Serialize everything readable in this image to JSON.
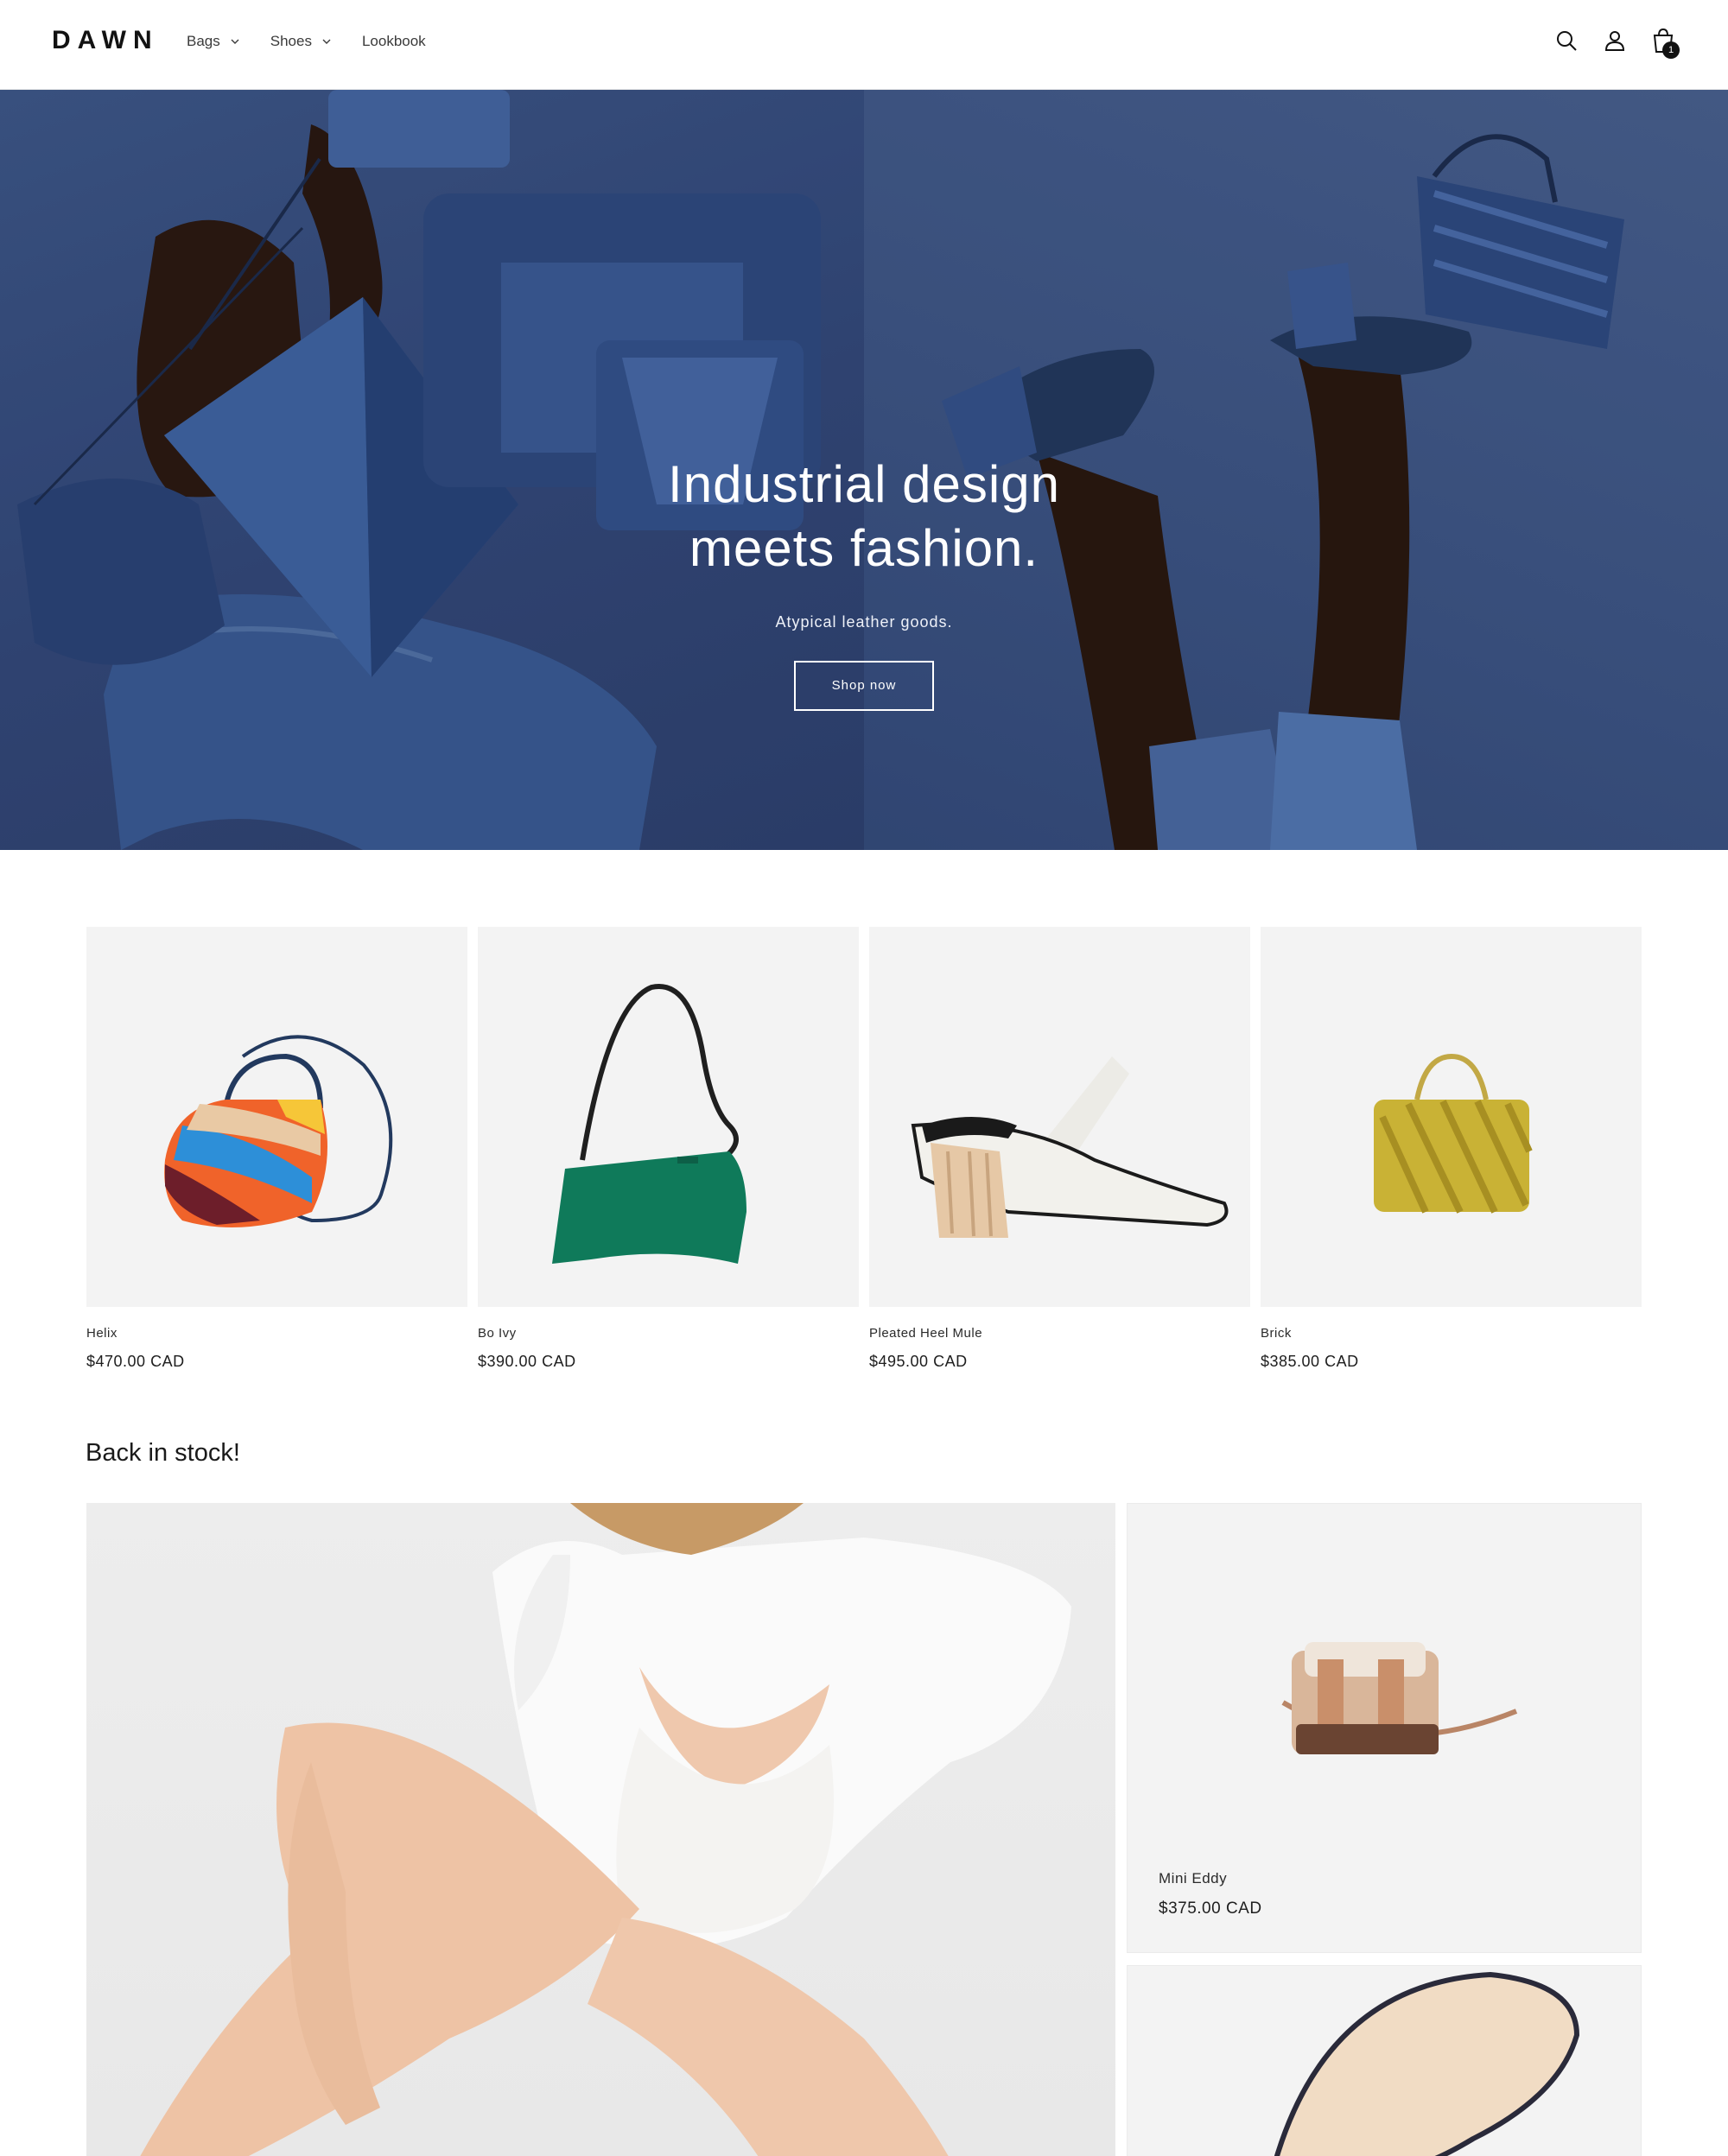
{
  "header": {
    "logo": "DAWN",
    "nav": [
      {
        "label": "Bags",
        "has_dropdown": true
      },
      {
        "label": "Shoes",
        "has_dropdown": true
      },
      {
        "label": "Lookbook",
        "has_dropdown": false
      }
    ],
    "icons": [
      "search-icon",
      "account-icon",
      "cart-icon"
    ],
    "cart_count": "1"
  },
  "hero": {
    "title_line1": "Industrial design",
    "title_line2": "meets fashion.",
    "subtitle": "Atypical leather goods.",
    "button_label": "Shop now"
  },
  "products": [
    {
      "title": "Helix",
      "price": "$470.00 CAD"
    },
    {
      "title": "Bo Ivy",
      "price": "$390.00 CAD"
    },
    {
      "title": "Pleated Heel Mule",
      "price": "$495.00 CAD"
    },
    {
      "title": "Brick",
      "price": "$385.00 CAD"
    }
  ],
  "back_in_stock": {
    "title": "Back in stock!",
    "featured": {
      "title": "Mini Eddy",
      "price": "$375.00 CAD"
    }
  },
  "colors": {
    "hero_blue": "#3e5685",
    "card_bg": "#f3f3f3",
    "text": "#121212"
  }
}
